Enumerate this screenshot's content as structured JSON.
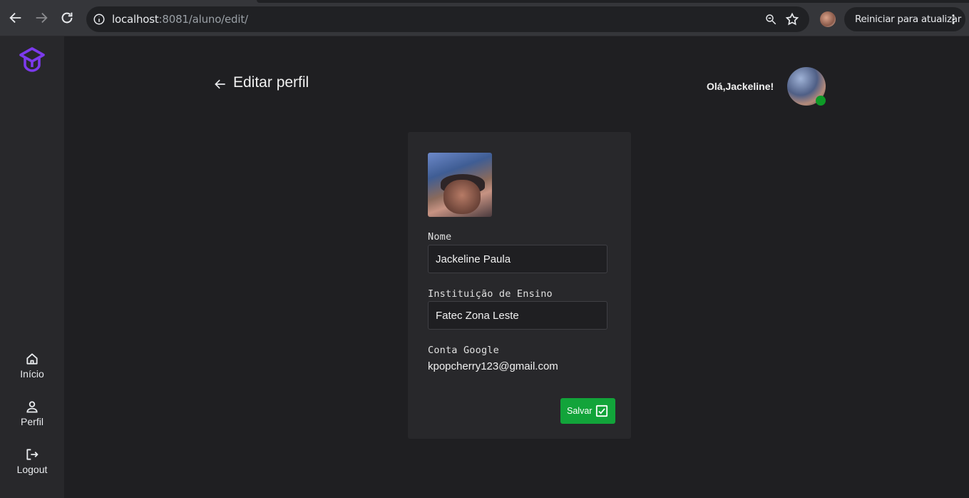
{
  "browser": {
    "url_host": "localhost",
    "url_rest": ":8081/aluno/edit/",
    "update_button_label": "Reiniciar para atualizar",
    "icons": [
      "back-icon",
      "forward-icon",
      "reload-icon",
      "info-icon",
      "zoom-icon",
      "star-icon",
      "more-icon"
    ]
  },
  "sidebar": {
    "logo": "graduation-cap-logo",
    "accent_color": "#7c3aed",
    "items": [
      {
        "label": "Início",
        "icon": "home-icon"
      },
      {
        "label": "Perfil",
        "icon": "user-icon"
      },
      {
        "label": "Logout",
        "icon": "logout-icon"
      }
    ]
  },
  "header": {
    "title": "Editar perfil",
    "greeting": "Olá,Jackeline!",
    "status_color": "#0e9a27"
  },
  "form": {
    "name_label": "Nome",
    "name_value": "Jackeline Paula",
    "institution_label": "Instituição de Ensino",
    "institution_value": "Fatec Zona Leste",
    "google_label": "Conta Google",
    "google_value": "kpopcherry123@gmail.com",
    "save_label": "Salvar",
    "save_color": "#12a43a"
  }
}
